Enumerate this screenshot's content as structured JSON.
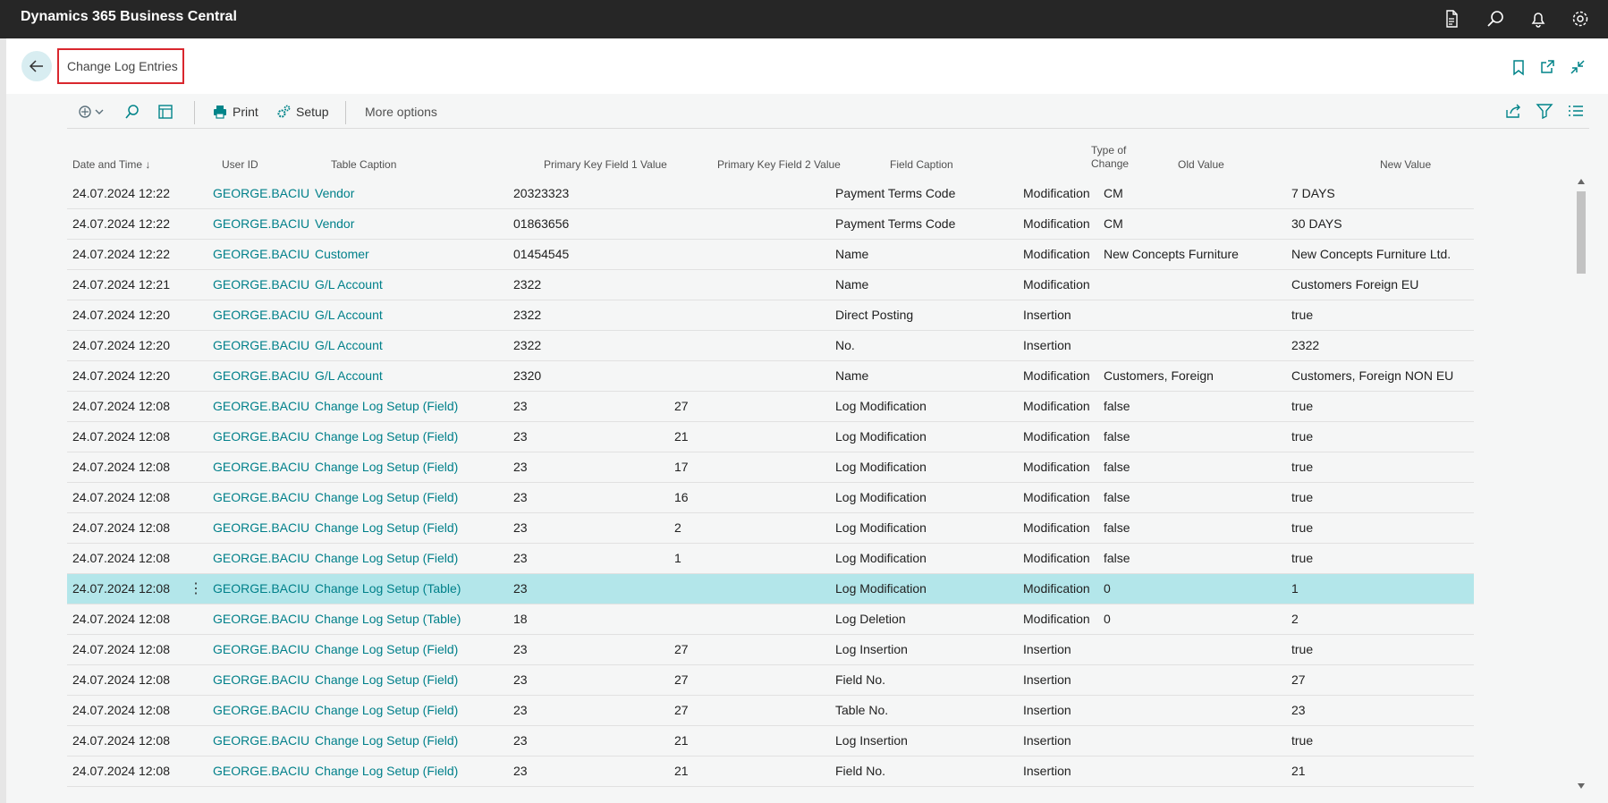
{
  "app": {
    "title": "Dynamics 365 Business Central"
  },
  "topbar_icons": [
    "document-icon",
    "search-icon",
    "bell-icon",
    "gear-icon"
  ],
  "page": {
    "title": "Change Log Entries"
  },
  "toolbar": {
    "print": "Print",
    "setup": "Setup",
    "more": "More options"
  },
  "columns": {
    "date_time": "Date and Time",
    "sort_indicator": "↓",
    "user_id": "User ID",
    "table_caption": "Table Caption",
    "pk1": "Primary Key Field 1 Value",
    "pk2": "Primary Key Field 2 Value",
    "field_caption": "Field Caption",
    "type_line1": "Type of",
    "type_line2": "Change",
    "old_value": "Old Value",
    "new_value": "New Value"
  },
  "colors": {
    "link": "#00808a",
    "selected_row": "#b3e6ea",
    "topbar": "#262626",
    "highlight_border": "#d9272e"
  },
  "rows": [
    {
      "dt": "24.07.2024 12:22",
      "user": "GEORGE.BACIU",
      "table": "Vendor",
      "pk1": "20323323",
      "pk2": "",
      "field": "Payment Terms Code",
      "type": "Modification",
      "old": "CM",
      "new": "7 DAYS"
    },
    {
      "dt": "24.07.2024 12:22",
      "user": "GEORGE.BACIU",
      "table": "Vendor",
      "pk1": "01863656",
      "pk2": "",
      "field": "Payment Terms Code",
      "type": "Modification",
      "old": "CM",
      "new": "30 DAYS"
    },
    {
      "dt": "24.07.2024 12:22",
      "user": "GEORGE.BACIU",
      "table": "Customer",
      "pk1": "01454545",
      "pk2": "",
      "field": "Name",
      "type": "Modification",
      "old": "New Concepts Furniture",
      "new": "New Concepts Furniture Ltd."
    },
    {
      "dt": "24.07.2024 12:21",
      "user": "GEORGE.BACIU",
      "table": "G/L Account",
      "pk1": "2322",
      "pk2": "",
      "field": "Name",
      "type": "Modification",
      "old": "",
      "new": "Customers Foreign EU"
    },
    {
      "dt": "24.07.2024 12:20",
      "user": "GEORGE.BACIU",
      "table": "G/L Account",
      "pk1": "2322",
      "pk2": "",
      "field": "Direct Posting",
      "type": "Insertion",
      "old": "",
      "new": "true"
    },
    {
      "dt": "24.07.2024 12:20",
      "user": "GEORGE.BACIU",
      "table": "G/L Account",
      "pk1": "2322",
      "pk2": "",
      "field": "No.",
      "type": "Insertion",
      "old": "",
      "new": "2322"
    },
    {
      "dt": "24.07.2024 12:20",
      "user": "GEORGE.BACIU",
      "table": "G/L Account",
      "pk1": "2320",
      "pk2": "",
      "field": "Name",
      "type": "Modification",
      "old": "Customers, Foreign",
      "new": "Customers, Foreign NON EU"
    },
    {
      "dt": "24.07.2024 12:08",
      "user": "GEORGE.BACIU",
      "table": "Change Log Setup (Field)",
      "pk1": "23",
      "pk2": "27",
      "field": "Log Modification",
      "type": "Modification",
      "old": "false",
      "new": "true"
    },
    {
      "dt": "24.07.2024 12:08",
      "user": "GEORGE.BACIU",
      "table": "Change Log Setup (Field)",
      "pk1": "23",
      "pk2": "21",
      "field": "Log Modification",
      "type": "Modification",
      "old": "false",
      "new": "true"
    },
    {
      "dt": "24.07.2024 12:08",
      "user": "GEORGE.BACIU",
      "table": "Change Log Setup (Field)",
      "pk1": "23",
      "pk2": "17",
      "field": "Log Modification",
      "type": "Modification",
      "old": "false",
      "new": "true"
    },
    {
      "dt": "24.07.2024 12:08",
      "user": "GEORGE.BACIU",
      "table": "Change Log Setup (Field)",
      "pk1": "23",
      "pk2": "16",
      "field": "Log Modification",
      "type": "Modification",
      "old": "false",
      "new": "true"
    },
    {
      "dt": "24.07.2024 12:08",
      "user": "GEORGE.BACIU",
      "table": "Change Log Setup (Field)",
      "pk1": "23",
      "pk2": "2",
      "field": "Log Modification",
      "type": "Modification",
      "old": "false",
      "new": "true"
    },
    {
      "dt": "24.07.2024 12:08",
      "user": "GEORGE.BACIU",
      "table": "Change Log Setup (Field)",
      "pk1": "23",
      "pk2": "1",
      "field": "Log Modification",
      "type": "Modification",
      "old": "false",
      "new": "true"
    },
    {
      "dt": "24.07.2024 12:08",
      "user": "GEORGE.BACIU",
      "table": "Change Log Setup (Table)",
      "pk1": "23",
      "pk2": "",
      "field": "Log Modification",
      "type": "Modification",
      "old": "0",
      "new": "1",
      "selected": true,
      "menu": "⋮"
    },
    {
      "dt": "24.07.2024 12:08",
      "user": "GEORGE.BACIU",
      "table": "Change Log Setup (Table)",
      "pk1": "18",
      "pk2": "",
      "field": "Log Deletion",
      "type": "Modification",
      "old": "0",
      "new": "2"
    },
    {
      "dt": "24.07.2024 12:08",
      "user": "GEORGE.BACIU",
      "table": "Change Log Setup (Field)",
      "pk1": "23",
      "pk2": "27",
      "field": "Log Insertion",
      "type": "Insertion",
      "old": "",
      "new": "true"
    },
    {
      "dt": "24.07.2024 12:08",
      "user": "GEORGE.BACIU",
      "table": "Change Log Setup (Field)",
      "pk1": "23",
      "pk2": "27",
      "field": "Field No.",
      "type": "Insertion",
      "old": "",
      "new": "27"
    },
    {
      "dt": "24.07.2024 12:08",
      "user": "GEORGE.BACIU",
      "table": "Change Log Setup (Field)",
      "pk1": "23",
      "pk2": "27",
      "field": "Table No.",
      "type": "Insertion",
      "old": "",
      "new": "23"
    },
    {
      "dt": "24.07.2024 12:08",
      "user": "GEORGE.BACIU",
      "table": "Change Log Setup (Field)",
      "pk1": "23",
      "pk2": "21",
      "field": "Log Insertion",
      "type": "Insertion",
      "old": "",
      "new": "true"
    },
    {
      "dt": "24.07.2024 12:08",
      "user": "GEORGE.BACIU",
      "table": "Change Log Setup (Field)",
      "pk1": "23",
      "pk2": "21",
      "field": "Field No.",
      "type": "Insertion",
      "old": "",
      "new": "21"
    }
  ]
}
